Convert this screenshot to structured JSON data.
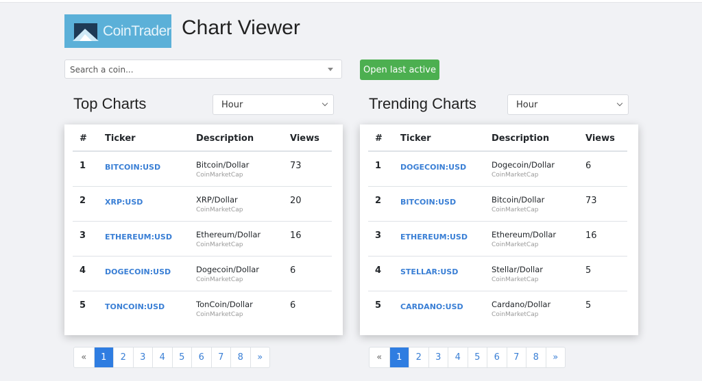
{
  "app": {
    "logo_text": "CoinTrader",
    "title": "Chart Viewer",
    "brand_color": "#5bb0d8",
    "accent": "#4caf50"
  },
  "search": {
    "placeholder": "Search a coin..."
  },
  "open_last_active": "Open last active",
  "headers": [
    "#",
    "Ticker",
    "Description",
    "Views"
  ],
  "panels": [
    {
      "title": "Top Charts",
      "period": "Hour",
      "rows": [
        {
          "n": "1",
          "ticker": "BITCOIN:USD",
          "desc": "Bitcoin/Dollar",
          "source": "CoinMarketCap",
          "views": "73"
        },
        {
          "n": "2",
          "ticker": "XRP:USD",
          "desc": "XRP/Dollar",
          "source": "CoinMarketCap",
          "views": "20"
        },
        {
          "n": "3",
          "ticker": "ETHEREUM:USD",
          "desc": "Ethereum/Dollar",
          "source": "CoinMarketCap",
          "views": "16"
        },
        {
          "n": "4",
          "ticker": "DOGECOIN:USD",
          "desc": "Dogecoin/Dollar",
          "source": "CoinMarketCap",
          "views": "6"
        },
        {
          "n": "5",
          "ticker": "TONCOIN:USD",
          "desc": "TonCoin/Dollar",
          "source": "CoinMarketCap",
          "views": "6"
        }
      ]
    },
    {
      "title": "Trending Charts",
      "period": "Hour",
      "rows": [
        {
          "n": "1",
          "ticker": "DOGECOIN:USD",
          "desc": "Dogecoin/Dollar",
          "source": "CoinMarketCap",
          "views": "6"
        },
        {
          "n": "2",
          "ticker": "BITCOIN:USD",
          "desc": "Bitcoin/Dollar",
          "source": "CoinMarketCap",
          "views": "73"
        },
        {
          "n": "3",
          "ticker": "ETHEREUM:USD",
          "desc": "Ethereum/Dollar",
          "source": "CoinMarketCap",
          "views": "16"
        },
        {
          "n": "4",
          "ticker": "STELLAR:USD",
          "desc": "Stellar/Dollar",
          "source": "CoinMarketCap",
          "views": "5"
        },
        {
          "n": "5",
          "ticker": "CARDANO:USD",
          "desc": "Cardano/Dollar",
          "source": "CoinMarketCap",
          "views": "5"
        }
      ]
    }
  ],
  "pagination": {
    "items": [
      "«",
      "1",
      "2",
      "3",
      "4",
      "5",
      "6",
      "7",
      "8",
      "»"
    ],
    "active": "1"
  }
}
